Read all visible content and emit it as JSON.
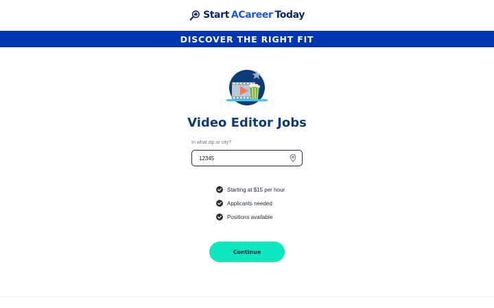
{
  "logo": {
    "part1": "Start",
    "part2": "ACareer",
    "part3": "Today",
    "icon": "magnifier-briefcase-icon"
  },
  "banner": {
    "text": "DISCOVER THE RIGHT FIT"
  },
  "hero": {
    "icon": "video-editing-illustration"
  },
  "page": {
    "title": "Video Editor Jobs"
  },
  "location": {
    "label": "In what zip or city?",
    "value": "12345",
    "icon": "location-pin-icon"
  },
  "features": [
    {
      "text": "Starting at $15 per hour",
      "icon": "check-circle-icon"
    },
    {
      "text": "Applicants needed",
      "icon": "check-circle-icon"
    },
    {
      "text": "Positions available",
      "icon": "check-circle-icon"
    }
  ],
  "cta": {
    "label": "Continue"
  },
  "colors": {
    "brand_navy": "#0b2a6b",
    "brand_blue": "#1c57d6",
    "banner_bg": "#0036b0",
    "title": "#0d3b7a",
    "button": "#0fe8bf"
  }
}
